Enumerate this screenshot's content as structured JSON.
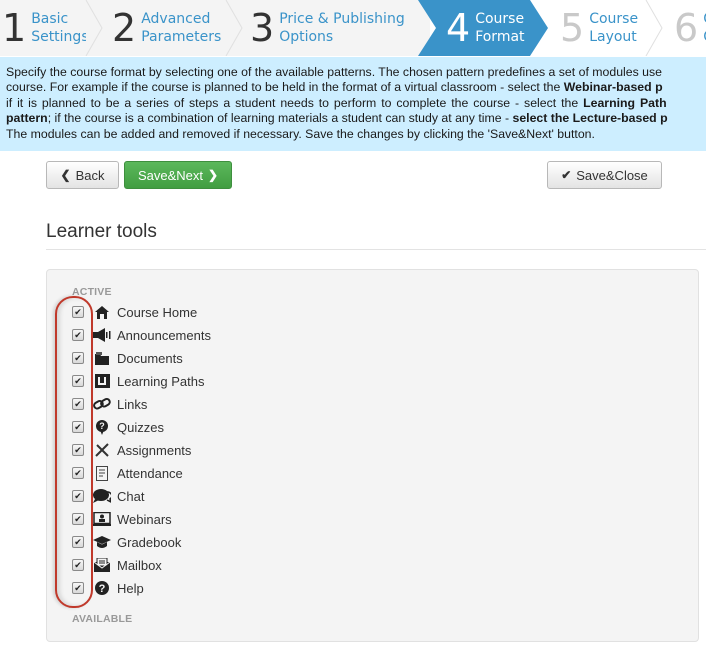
{
  "wizard": {
    "steps": [
      {
        "number": "1",
        "line1": "Basic",
        "line2": "Settings",
        "state": "done"
      },
      {
        "number": "2",
        "line1": "Advanced",
        "line2": "Parameters",
        "state": "done"
      },
      {
        "number": "3",
        "line1": "Price & Publishing",
        "line2": "Options",
        "state": "done"
      },
      {
        "number": "4",
        "line1": "Course",
        "line2": "Format",
        "state": "active"
      },
      {
        "number": "5",
        "line1": "Course",
        "line2": "Layout",
        "state": "todo"
      },
      {
        "number": "6",
        "line1": "C",
        "line2": "C",
        "state": "todo"
      }
    ],
    "active_color": "#3a93c9"
  },
  "info": {
    "l1": "Specify the course format by selecting one of the available patterns. The chosen pattern predefines a set of modules use",
    "l2a": "course. For example if the course is planned to be held in the format of a virtual classroom - select the ",
    "l2b": "Webinar-based p",
    "l3a": "if it is planned to be a series of steps a student needs to perform to complete the course - select the ",
    "l3b": "Learning Path",
    "l4a": "pattern",
    "l4b": "; if the course is a combination of learning materials a student can study at any time - ",
    "l4c": "select the Lecture-based p",
    "l5": "The modules can be added and removed if necessary. Save the changes by clicking the 'Save&Next' button."
  },
  "toolbar": {
    "back_label": "Back",
    "save_next_label": "Save&Next",
    "save_close_label": "Save&Close"
  },
  "section": {
    "title": "Learner tools",
    "active_label": "ACTIVE",
    "available_label": "AVAILABLE",
    "tools": [
      {
        "label": "Course Home",
        "icon": "home-icon",
        "checked": true
      },
      {
        "label": "Announcements",
        "icon": "megaphone-icon",
        "checked": true
      },
      {
        "label": "Documents",
        "icon": "folder-icon",
        "checked": true
      },
      {
        "label": "Learning Paths",
        "icon": "learning-path-icon",
        "checked": true
      },
      {
        "label": "Links",
        "icon": "link-icon",
        "checked": true
      },
      {
        "label": "Quizzes",
        "icon": "quiz-icon",
        "checked": true
      },
      {
        "label": "Assignments",
        "icon": "assignment-icon",
        "checked": true
      },
      {
        "label": "Attendance",
        "icon": "attendance-icon",
        "checked": true
      },
      {
        "label": "Chat",
        "icon": "chat-icon",
        "checked": true
      },
      {
        "label": "Webinars",
        "icon": "webinar-icon",
        "checked": true
      },
      {
        "label": "Gradebook",
        "icon": "graduation-cap-icon",
        "checked": true
      },
      {
        "label": "Mailbox",
        "icon": "mailbox-icon",
        "checked": true
      },
      {
        "label": "Help",
        "icon": "help-icon",
        "checked": true
      }
    ]
  }
}
